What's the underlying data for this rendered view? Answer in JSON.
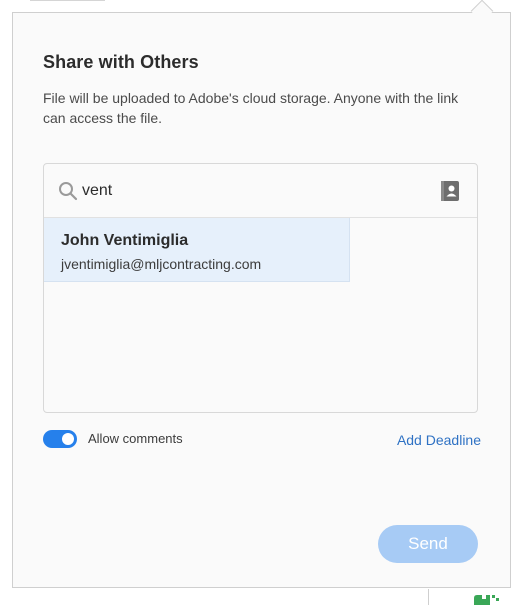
{
  "dialog": {
    "title": "Share with Others",
    "description": "File will be uploaded to Adobe's cloud storage. Anyone with the link can access the file."
  },
  "search": {
    "value": "vent",
    "placeholder": ""
  },
  "suggestions": [
    {
      "name": "John Ventimiglia",
      "email": "jventimiglia@mljcontracting.com"
    }
  ],
  "options": {
    "allow_comments_label": "Allow comments",
    "allow_comments_on": true,
    "add_deadline_label": "Add Deadline"
  },
  "actions": {
    "send_label": "Send"
  },
  "colors": {
    "accent": "#2680eb",
    "link": "#2f72c4",
    "send_disabled": "#a7cbf5",
    "suggestion_bg": "#e6f0fb"
  },
  "icons": {
    "search": "search-icon",
    "contacts": "address-book-icon",
    "app": "app-icon"
  }
}
